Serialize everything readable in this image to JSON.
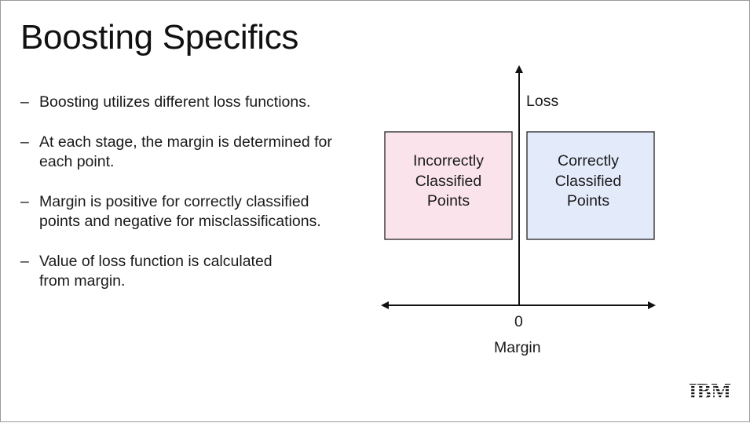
{
  "slide": {
    "title": "Boosting Specifics",
    "bullets": [
      {
        "dash": "–",
        "text": "Boosting utilizes different loss functions."
      },
      {
        "dash": "–",
        "text": "At each stage, the margin is determined for each point."
      },
      {
        "dash": "–",
        "text": "Margin is positive for correctly classified points and negative for misclassifications."
      },
      {
        "dash": "–",
        "text": "Value of loss function is calculated from margin."
      }
    ]
  },
  "diagram": {
    "y_axis_label": "Loss",
    "x_axis_label": "Margin",
    "origin_label": "0",
    "left_box": {
      "line1": "Incorrectly",
      "line2": "Classified",
      "line3": "Points",
      "fill": "#fbe3ec"
    },
    "right_box": {
      "line1": "Correctly",
      "line2": "Classified",
      "line3": "Points",
      "fill": "#e3ebfb"
    }
  },
  "logo": {
    "text": "IBM"
  }
}
